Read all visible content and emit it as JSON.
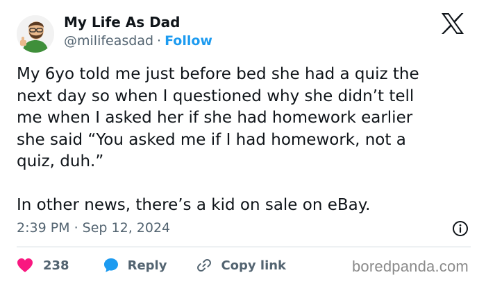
{
  "tweet": {
    "author_name": "My Life As Dad",
    "handle": "@milifeasdad",
    "separator": "·",
    "follow_label": "Follow",
    "text": "My 6yo told me just before bed she had a quiz the\nnext day so when I questioned why she didn’t tell\nme when I asked her if she had homework earlier\nshe said “You asked me if I had homework, not a\nquiz, duh.”\n\nIn other news, there’s a kid on sale on eBay.",
    "timestamp": "2:39 PM · Sep 12, 2024",
    "like_count": "238",
    "reply_label": "Reply",
    "copy_link_label": "Copy link"
  },
  "watermark": "boredpanda.com",
  "icons": {
    "brand": "x-logo-icon",
    "info": "info-icon",
    "like": "heart-icon",
    "reply": "reply-bubble-icon",
    "copy": "link-icon"
  },
  "colors": {
    "text": "#0f1419",
    "secondary": "#536471",
    "follow": "#1d9bf0",
    "heart": "#f91880",
    "reply_icon": "#1d9bf0",
    "divider": "#cfd9de"
  }
}
